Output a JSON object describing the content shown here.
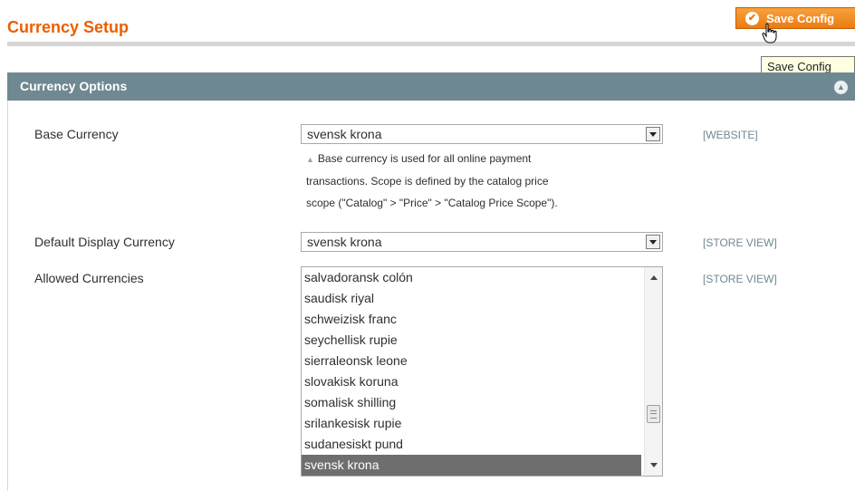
{
  "header": {
    "title": "Currency Setup",
    "save_button": "Save Config",
    "tooltip": "Save Config"
  },
  "section": {
    "title": "Currency Options"
  },
  "fields": {
    "base_currency": {
      "label": "Base Currency",
      "value": "svensk krona",
      "scope": "[WEBSITE]",
      "note_lines": [
        "Base currency is used for all online payment",
        "transactions. Scope is defined by the catalog price",
        "scope (\"Catalog\" > \"Price\" > \"Catalog Price Scope\")."
      ]
    },
    "default_display_currency": {
      "label": "Default Display Currency",
      "value": "svensk krona",
      "scope": "[STORE VIEW]"
    },
    "allowed_currencies": {
      "label": "Allowed Currencies",
      "scope": "[STORE VIEW]",
      "options": [
        "salvadoransk colón",
        "saudisk riyal",
        "schweizisk franc",
        "seychellisk rupie",
        "sierraleonsk leone",
        "slovakisk koruna",
        "somalisk shilling",
        "srilankesisk rupie",
        "sudanesiskt pund",
        "svensk krona"
      ],
      "selected": "svensk krona"
    }
  },
  "colors": {
    "accent": "#eb5e00",
    "section_header": "#6f8992",
    "button": "#ec7b12",
    "selected_row": "#6e6e6e"
  },
  "icons": [
    "check-circle-icon",
    "hand-cursor-icon",
    "collapse-arrow-icon",
    "dropdown-arrow-icon",
    "note-triangle-icon"
  ]
}
